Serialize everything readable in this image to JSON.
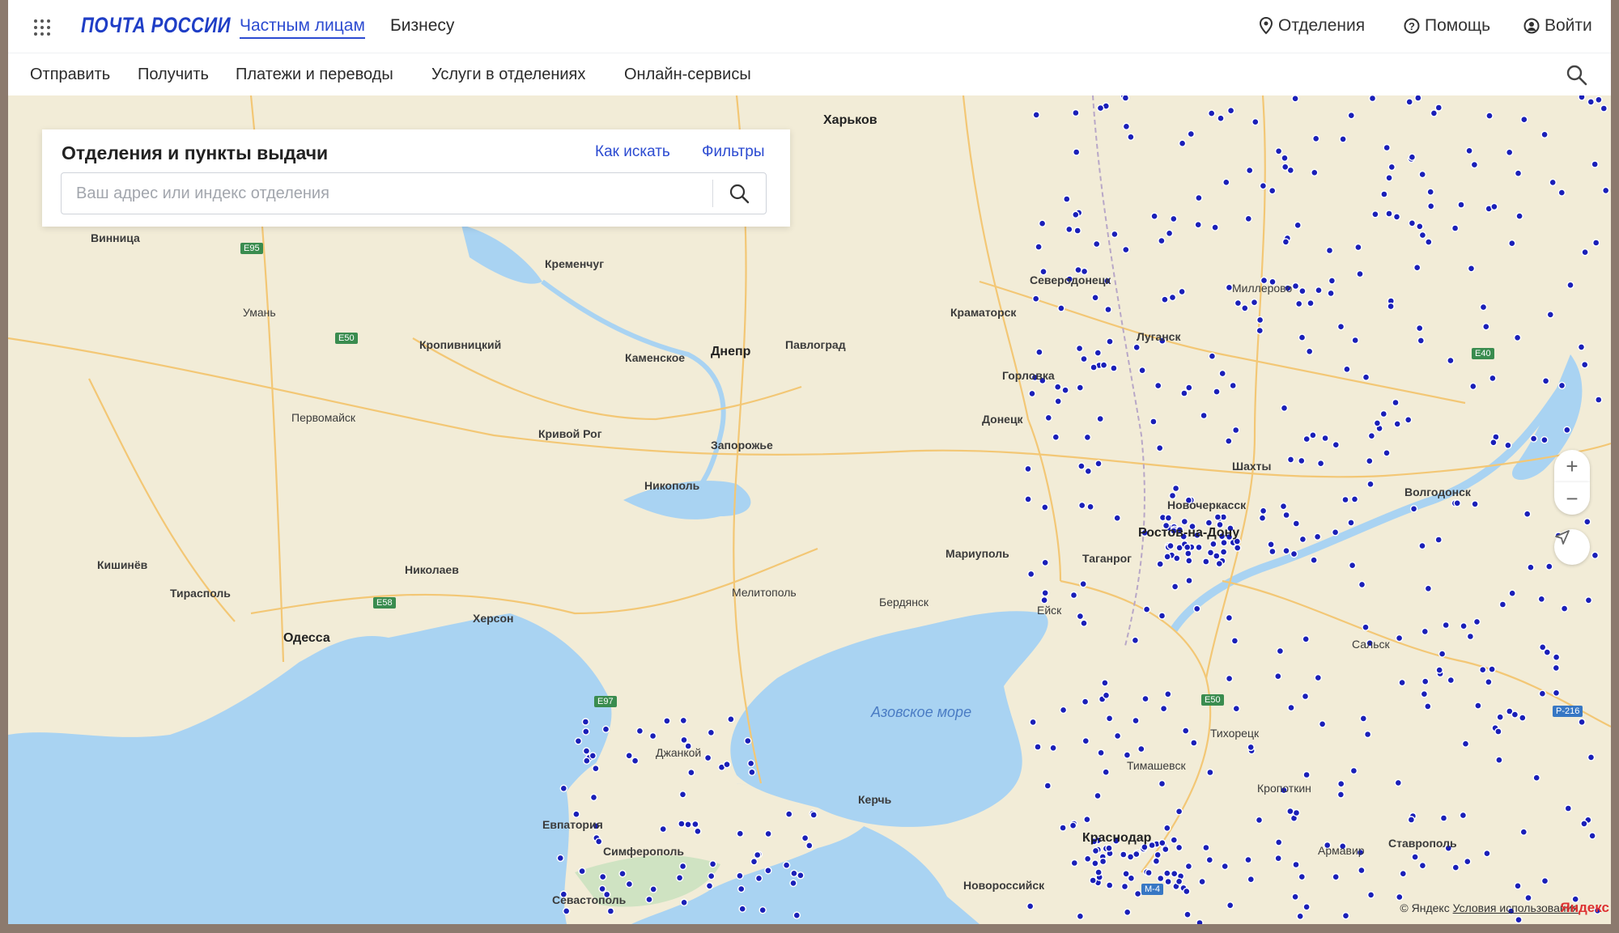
{
  "header": {
    "logo": "ПОЧТА РОССИИ",
    "nav_private": "Частным лицам",
    "nav_business": "Бизнесу",
    "offices": "Отделения",
    "help": "Помощь",
    "login": "Войти"
  },
  "subnav": [
    "Отправить",
    "Получить",
    "Платежи и переводы",
    "Услуги в отделениях",
    "Онлайн-сервисы"
  ],
  "panel": {
    "title": "Отделения и пункты выдачи",
    "how_link": "Как искать",
    "filters_link": "Фильтры",
    "search_placeholder": "Ваш адрес или индекс отделения"
  },
  "map": {
    "sea_label": "Азовское море",
    "cities": [
      "Харьков",
      "Днепр",
      "Запорожье",
      "Кривой Рог",
      "Одесса",
      "Николаев",
      "Херсон",
      "Мелитополь",
      "Мариуполь",
      "Донецк",
      "Луганск",
      "Ростов-на-Дону",
      "Таганрог",
      "Краснодар",
      "Новороссийск",
      "Симферополь",
      "Севастополь",
      "Евпатория",
      "Керчь",
      "Кропивницкий",
      "Кременчуг",
      "Каменское",
      "Павлоград",
      "Краматорск",
      "Горловка",
      "Северодонецк",
      "Бердянск",
      "Ейск",
      "Шахты",
      "Новочеркасск",
      "Ставрополь",
      "Армавир",
      "Тихорецк",
      "Кропоткин",
      "Винница",
      "Умань",
      "Первомайск",
      "Тирасполь",
      "Кишинёв",
      "Никополь",
      "Миллерово",
      "Волгодонск",
      "Сальск",
      "Тимашевск",
      "Джанкой"
    ],
    "road_labels": [
      "E95",
      "E50",
      "E58",
      "E97",
      "E40",
      "E50",
      "P-216",
      "M-4"
    ]
  },
  "controls": {
    "zoom_in": "+",
    "zoom_out": "−"
  },
  "footer": {
    "copyright": "© Яндекс",
    "terms": "Условия использования",
    "brand": "Яндекс"
  },
  "colors": {
    "brand": "#1f3ec6",
    "accent": "#2c4bd1",
    "marker": "#1a1fb8",
    "water": "#a9d3f2"
  }
}
